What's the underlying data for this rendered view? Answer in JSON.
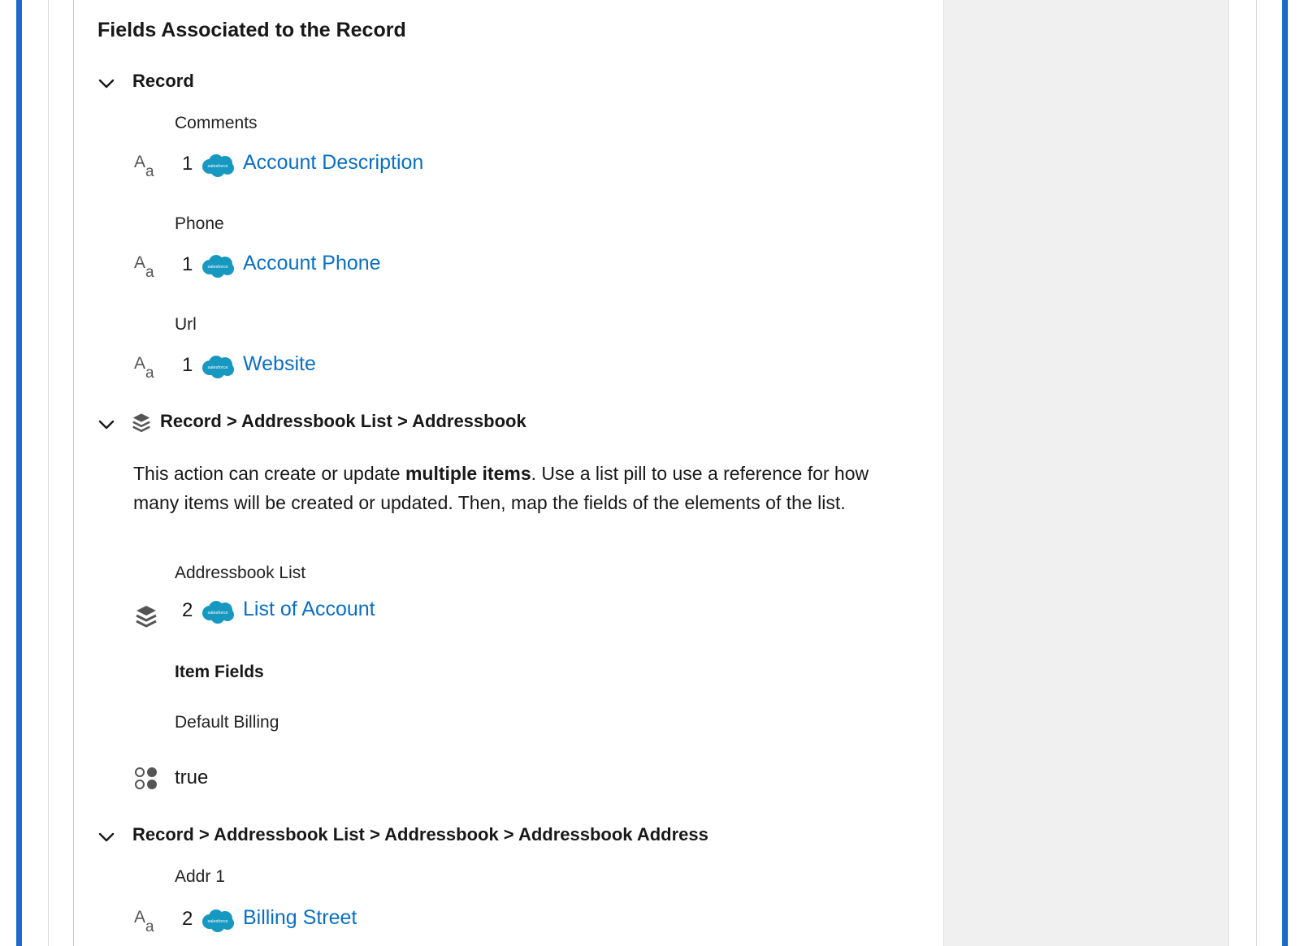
{
  "page_title": "Fields Associated to the Record",
  "sections": [
    {
      "heading": "Record",
      "fields": [
        {
          "label": "Comments",
          "order": "1",
          "value": "Account Description"
        },
        {
          "label": "Phone",
          "order": "1",
          "value": "Account Phone"
        },
        {
          "label": "Url",
          "order": "1",
          "value": "Website"
        }
      ]
    },
    {
      "heading": "Record > Addressbook List > Addressbook",
      "description": {
        "before": "This action can create or update ",
        "bold": "multiple items",
        "after": ". Use a list pill to use a reference for how many items will be created or updated. Then, map the fields of the elements of the list."
      },
      "list_field": {
        "label": "Addressbook List",
        "order": "2",
        "value": "List of Account"
      },
      "item_fields_heading": "Item Fields",
      "item_field": {
        "label": "Default Billing",
        "value": "true"
      }
    },
    {
      "heading": "Record > Addressbook List > Addressbook > Addressbook Address",
      "fields": [
        {
          "label": "Addr 1",
          "order": "2",
          "value": "Billing Street"
        }
      ]
    }
  ],
  "icons": {
    "chevron": "chevron-down-icon",
    "text_type": "text-type-icon",
    "salesforce": "salesforce-cloud-icon",
    "list": "layers-icon",
    "boolean": "boolean-icon"
  },
  "salesforce_logo_text": "salesforce",
  "colors": {
    "frame_border": "#1b6ac9",
    "link": "#0b6fc0",
    "salesforce_cloud": "#1798c1",
    "side_panel": "#f0f0f0"
  }
}
